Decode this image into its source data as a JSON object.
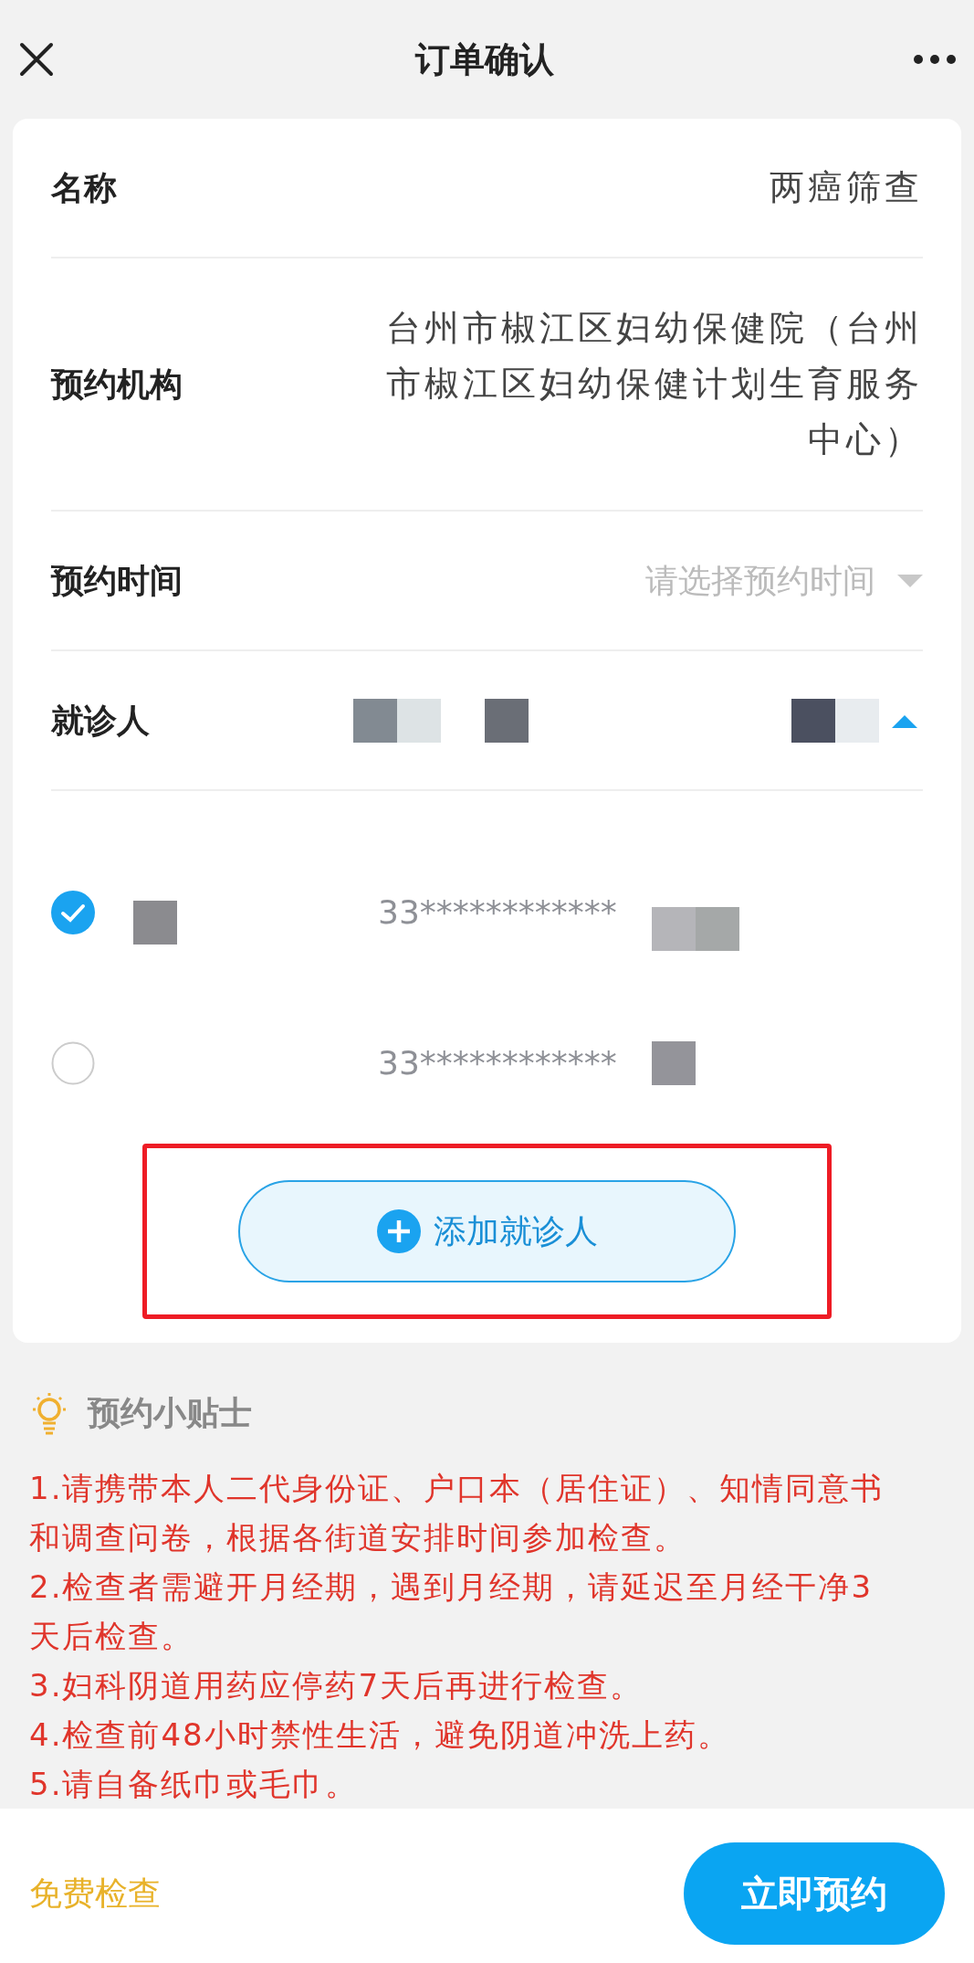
{
  "header": {
    "title": "订单确认"
  },
  "fields": [
    {
      "kind": "text",
      "label": "名称",
      "value": "两癌筛查"
    },
    {
      "kind": "text",
      "label": "预约机构",
      "value": "台州市椒江区妇幼保健院（台州市椒江区妇幼保健计划生育服务中心）"
    },
    {
      "kind": "select",
      "label": "预约时间",
      "placeholder": "请选择预约时间",
      "expanded": false
    },
    {
      "kind": "redacted",
      "label": "就诊人",
      "expanded": true
    }
  ],
  "patients": [
    {
      "selected": true,
      "id_number": "33************"
    },
    {
      "selected": false,
      "id_number": "33************"
    }
  ],
  "add_patient": {
    "label": "添加就诊人",
    "highlighted": true
  },
  "tips": {
    "title": "预约小贴士",
    "items": [
      "1.请携带本人二代身份证、户口本（居住证）、知情同意书和调查问卷，根据各街道安排时间参加检查。",
      "2.检查者需避开月经期，遇到月经期，请延迟至月经干净3天后检查。",
      "3.妇科阴道用药应停药7天后再进行检查。",
      "4.检查前48小时禁性生活，避免阴道冲洗上药。",
      "5.请自备纸巾或毛巾。"
    ]
  },
  "footer": {
    "note": "免费检查",
    "button": "立即预约"
  }
}
